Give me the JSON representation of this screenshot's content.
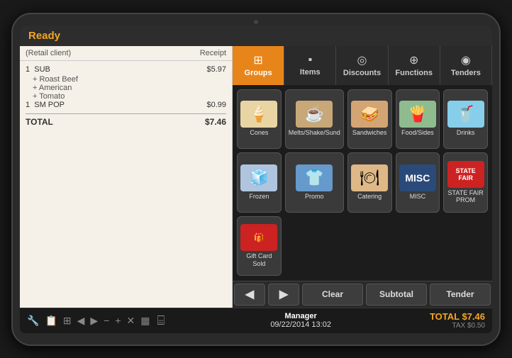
{
  "header": {
    "ready_label": "Ready"
  },
  "receipt": {
    "client_label": "(Retail client)",
    "receipt_label": "Receipt",
    "items": [
      {
        "qty": "1",
        "name": "SUB",
        "price": "$5.97"
      },
      {
        "modifier": "+ Roast Beef"
      },
      {
        "modifier": "+ American"
      },
      {
        "modifier": "+ Tomato"
      },
      {
        "qty": "1",
        "name": "SM POP",
        "price": "$0.99"
      }
    ],
    "total_label": "TOTAL",
    "total_value": "$7.46"
  },
  "tabs": [
    {
      "id": "groups",
      "label": "Groups",
      "icon": "⊞",
      "active": true
    },
    {
      "id": "items",
      "label": "Items",
      "icon": "▪"
    },
    {
      "id": "discounts",
      "label": "Discounts",
      "icon": "◎"
    },
    {
      "id": "functions",
      "label": "Functions",
      "icon": "⊕"
    },
    {
      "id": "tenders",
      "label": "Tenders",
      "icon": "◉"
    }
  ],
  "grid_items": [
    {
      "id": "cones",
      "label": "Cones",
      "emoji": "🍦",
      "bg": "#e8d5a3"
    },
    {
      "id": "melts",
      "label": "Melts/Shake/Sund",
      "emoji": "☕",
      "bg": "#c8a878"
    },
    {
      "id": "sandwiches",
      "label": "Sandwiches",
      "emoji": "🥪",
      "bg": "#d4a574"
    },
    {
      "id": "food-sides",
      "label": "Food/Sides",
      "emoji": "🍟",
      "bg": "#8fbc8f"
    },
    {
      "id": "drinks",
      "label": "Drinks",
      "emoji": "🥤",
      "bg": "#87ceeb"
    },
    {
      "id": "frozen",
      "label": "Frozen",
      "emoji": "🧊",
      "bg": "#b0c4de"
    },
    {
      "id": "promo",
      "label": "Promo",
      "emoji": "👕",
      "bg": "#6699cc"
    },
    {
      "id": "catering",
      "label": "Catering",
      "emoji": "🍽",
      "bg": "#deb887"
    },
    {
      "id": "misc",
      "label": "MISC",
      "special": "MISC",
      "bg": "#2a4a7a",
      "text_color": "#fff"
    },
    {
      "id": "statefair",
      "label": "STATE FAIR PROM",
      "special": "STATEFAIR",
      "bg": "#cc2222",
      "text_color": "#fff"
    },
    {
      "id": "giftcard",
      "label": "Gift Card Sold",
      "special": "GIFT",
      "bg": "#cc2222",
      "text_color": "gold"
    }
  ],
  "action_bar": {
    "prev_icon": "◀",
    "next_icon": "▶",
    "clear_label": "Clear",
    "subtotal_label": "Subtotal",
    "tender_label": "Tender"
  },
  "bottom_bar": {
    "manager_label": "Manager",
    "datetime": "09/22/2014  13:02",
    "total_label": "TOTAL $7.46",
    "tax_label": "TAX $0.50",
    "tools": [
      "🔧",
      "📋",
      "⊞",
      "◀",
      "▶",
      "−",
      "+",
      "✕",
      "▦"
    ]
  }
}
